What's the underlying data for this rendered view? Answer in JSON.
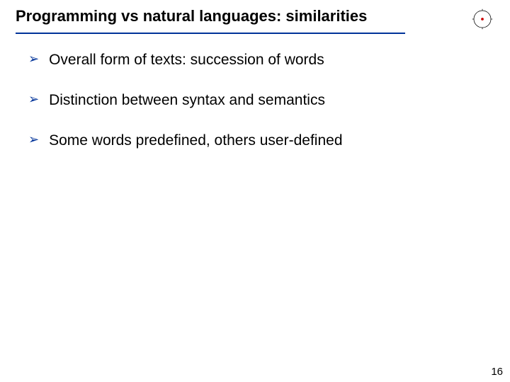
{
  "title": "Programming vs natural languages: similarities",
  "bullets": [
    {
      "mark": "➢",
      "text": "Overall form of texts: succession of words"
    },
    {
      "mark": "➢",
      "text": "Distinction between syntax and semantics"
    },
    {
      "mark": "➢",
      "text": "Some words predefined, others user-defined"
    }
  ],
  "page_number": "16",
  "colors": {
    "accent": "#003399"
  }
}
